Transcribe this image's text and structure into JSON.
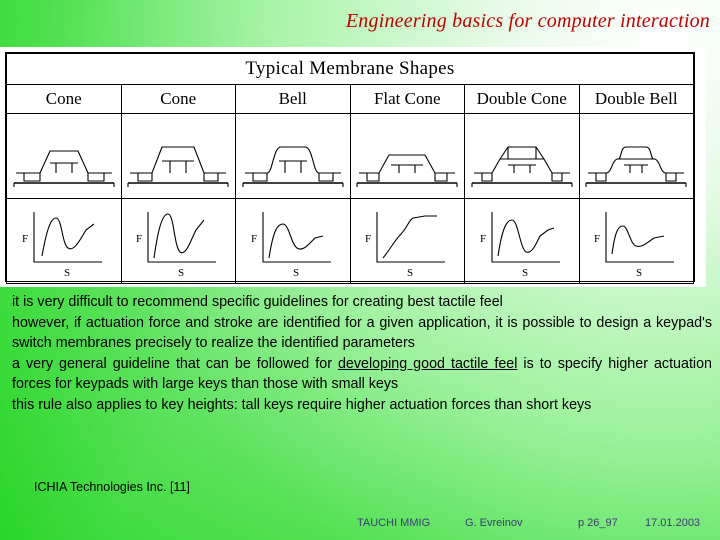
{
  "slide": {
    "title": "Engineering basics for computer interaction",
    "title_color": "#c00000"
  },
  "table": {
    "caption": "Typical Membrane Shapes",
    "columns": [
      "Cone",
      "Cone",
      "Bell",
      "Flat Cone",
      "Double Cone",
      "Double Bell"
    ],
    "graph_axis_y": "F",
    "graph_axis_x": "S"
  },
  "body": {
    "line1": "it is very difficult to recommend specific guidelines for creating best tactile feel",
    "line2": "however, if actuation force and stroke are identified for a given application, it is possible to design a keypad's switch membranes precisely to realize the identified parameters",
    "line3_a": "a very general guideline that can be followed for ",
    "line3_u": "developing good tactile feel",
    "line3_b": " is to specify higher actuation forces for keypads with large keys than those with small keys",
    "line4": "this rule also applies to key heights: tall keys require higher actuation forces than short keys"
  },
  "footer": {
    "source": "ICHIA Technologies Inc. [11]",
    "org": "TAUCHI MMIG",
    "author": "G. Evreinov",
    "page": "p 26_97",
    "date": "17.01.2003"
  }
}
